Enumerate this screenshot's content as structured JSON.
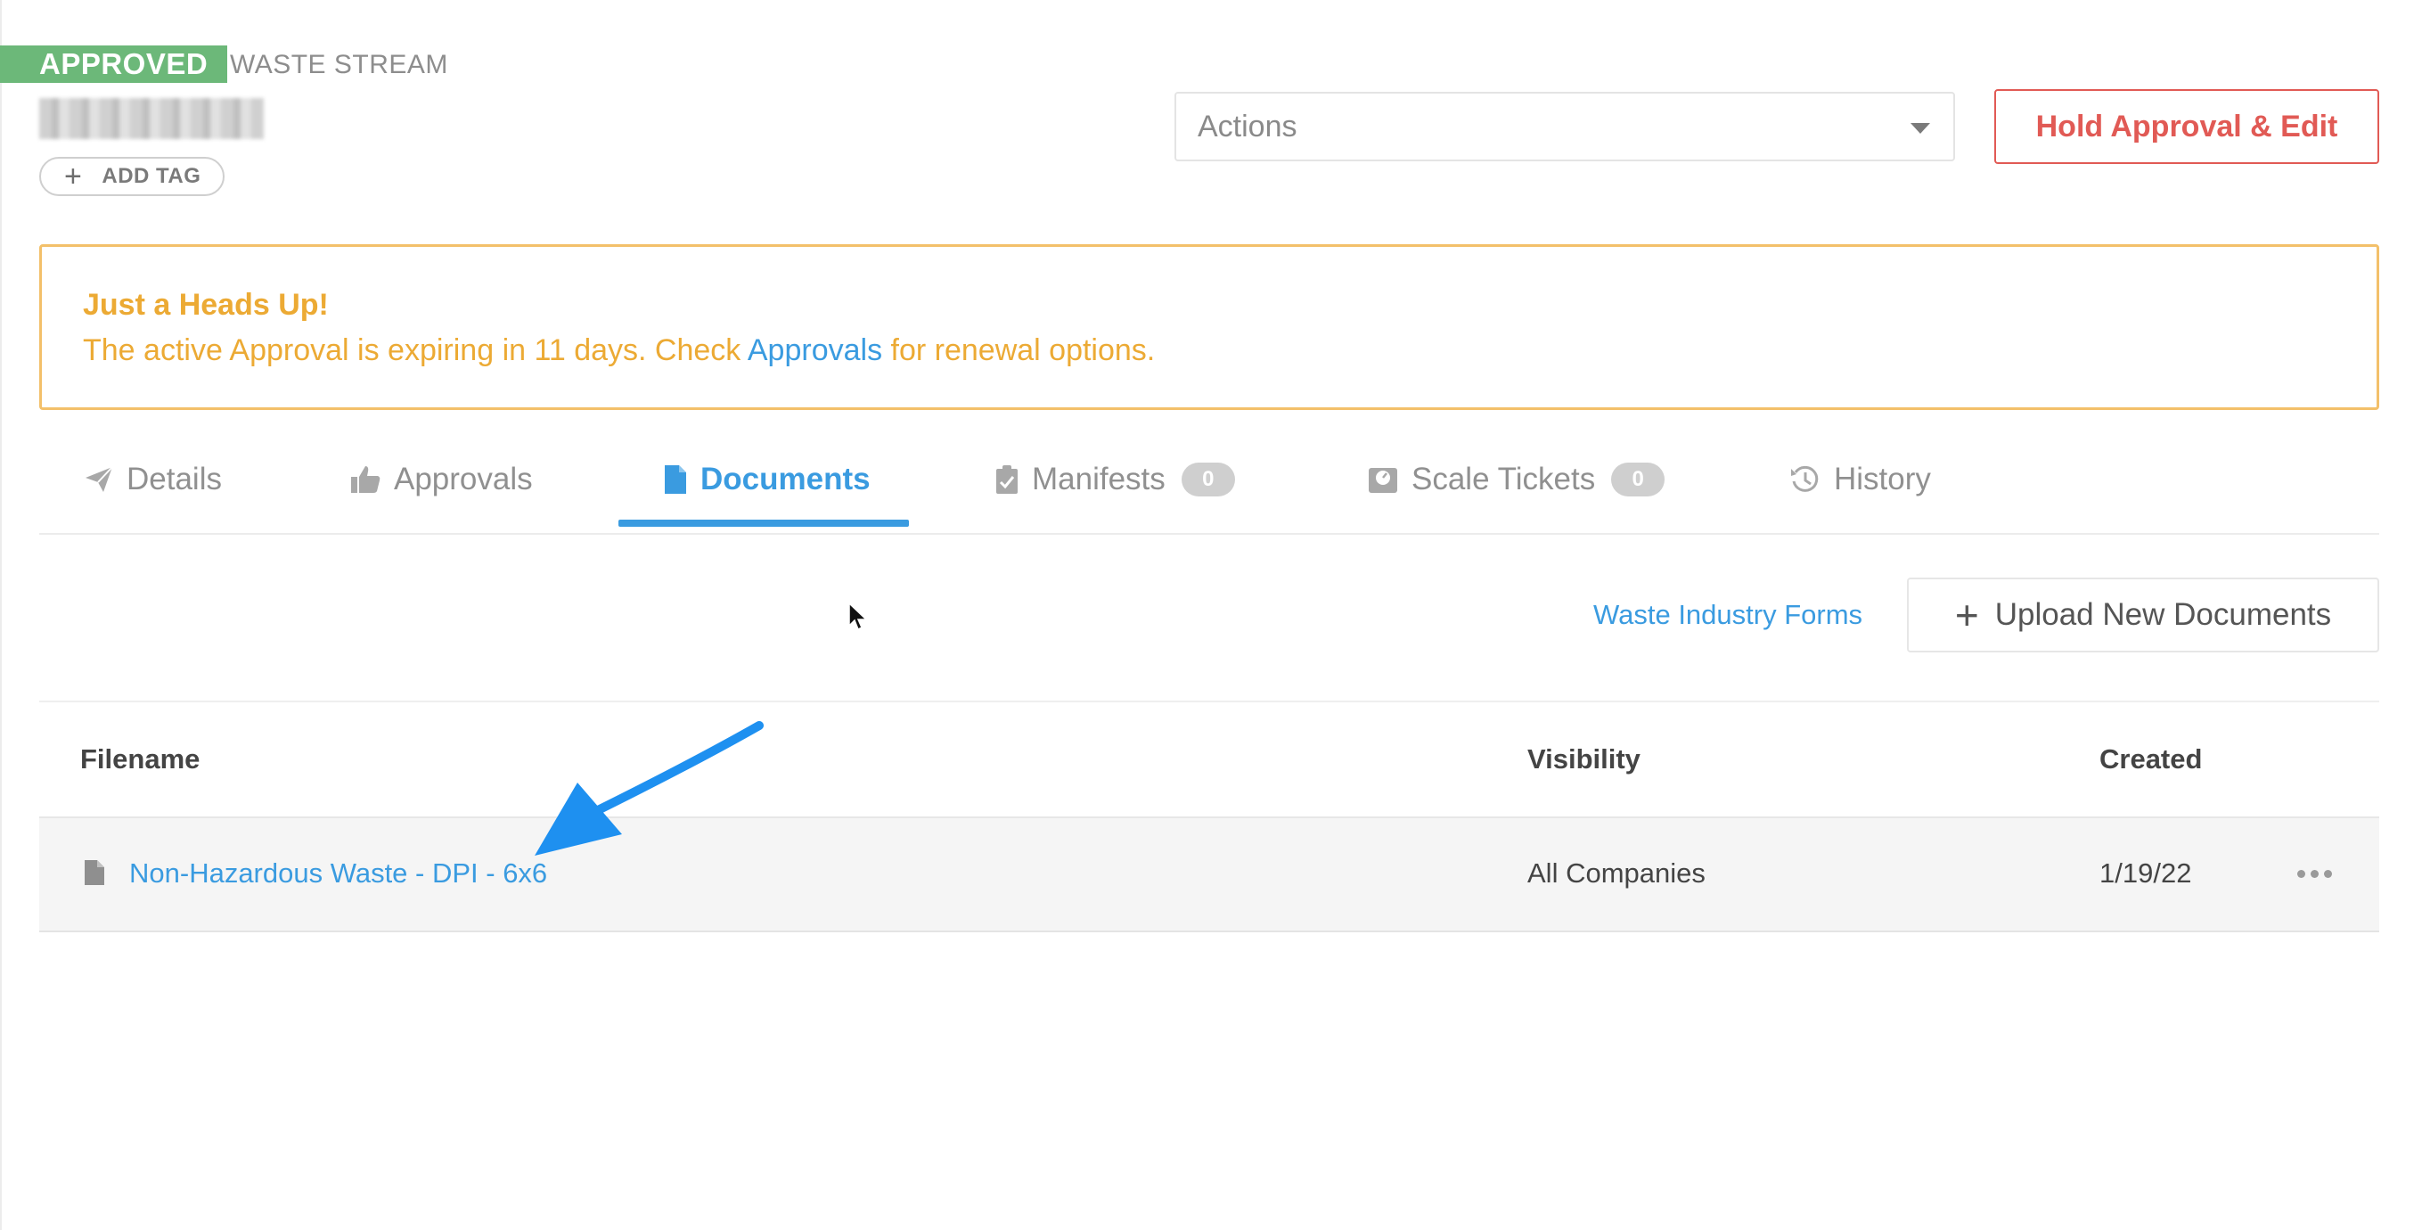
{
  "header": {
    "status": "APPROVED",
    "record_type": "WASTE STREAM",
    "add_tag_label": "ADD TAG",
    "actions_placeholder": "Actions",
    "hold_button_label": "Hold Approval & Edit"
  },
  "alert": {
    "title": "Just a Heads Up!",
    "text_before": "The active Approval is expiring in 11 days. Check ",
    "link_text": "Approvals",
    "text_after": " for renewal options.",
    "color": "#ecaa34"
  },
  "tabs": [
    {
      "label": "Details",
      "icon": "paper-plane-icon"
    },
    {
      "label": "Approvals",
      "icon": "thumbs-up-icon"
    },
    {
      "label": "Documents",
      "icon": "document-icon",
      "active": true
    },
    {
      "label": "Manifests",
      "icon": "clipboard-check-icon",
      "count": "0"
    },
    {
      "label": "Scale Tickets",
      "icon": "scale-icon",
      "count": "0"
    },
    {
      "label": "History",
      "icon": "history-icon"
    }
  ],
  "documents_toolbar": {
    "forms_link": "Waste Industry Forms",
    "upload_label": "Upload New Documents"
  },
  "table": {
    "columns": [
      "Filename",
      "Visibility",
      "Created"
    ],
    "rows": [
      {
        "filename": "Non-Hazardous Waste - DPI - 6x6",
        "visibility": "All Companies",
        "created": "1/19/22"
      }
    ]
  },
  "colors": {
    "accent": "#3a9be0",
    "approved": "#6cb879",
    "danger": "#e15a55",
    "warning_border": "#f3c06a",
    "annotation_arrow": "#1e90f0"
  }
}
